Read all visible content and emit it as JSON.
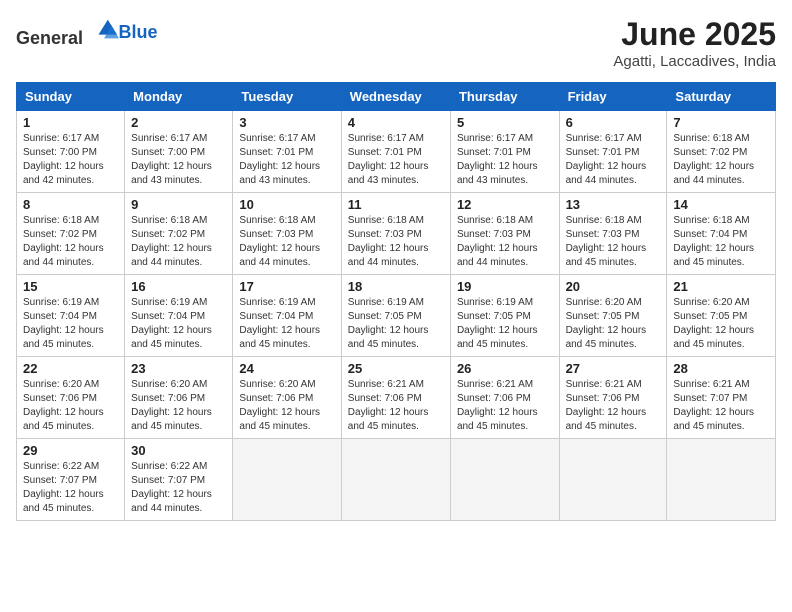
{
  "header": {
    "logo_general": "General",
    "logo_blue": "Blue",
    "month": "June 2025",
    "location": "Agatti, Laccadives, India"
  },
  "weekdays": [
    "Sunday",
    "Monday",
    "Tuesday",
    "Wednesday",
    "Thursday",
    "Friday",
    "Saturday"
  ],
  "weeks": [
    [
      {
        "day": "1",
        "info": "Sunrise: 6:17 AM\nSunset: 7:00 PM\nDaylight: 12 hours\nand 42 minutes."
      },
      {
        "day": "2",
        "info": "Sunrise: 6:17 AM\nSunset: 7:00 PM\nDaylight: 12 hours\nand 43 minutes."
      },
      {
        "day": "3",
        "info": "Sunrise: 6:17 AM\nSunset: 7:01 PM\nDaylight: 12 hours\nand 43 minutes."
      },
      {
        "day": "4",
        "info": "Sunrise: 6:17 AM\nSunset: 7:01 PM\nDaylight: 12 hours\nand 43 minutes."
      },
      {
        "day": "5",
        "info": "Sunrise: 6:17 AM\nSunset: 7:01 PM\nDaylight: 12 hours\nand 43 minutes."
      },
      {
        "day": "6",
        "info": "Sunrise: 6:17 AM\nSunset: 7:01 PM\nDaylight: 12 hours\nand 44 minutes."
      },
      {
        "day": "7",
        "info": "Sunrise: 6:18 AM\nSunset: 7:02 PM\nDaylight: 12 hours\nand 44 minutes."
      }
    ],
    [
      {
        "day": "8",
        "info": "Sunrise: 6:18 AM\nSunset: 7:02 PM\nDaylight: 12 hours\nand 44 minutes."
      },
      {
        "day": "9",
        "info": "Sunrise: 6:18 AM\nSunset: 7:02 PM\nDaylight: 12 hours\nand 44 minutes."
      },
      {
        "day": "10",
        "info": "Sunrise: 6:18 AM\nSunset: 7:03 PM\nDaylight: 12 hours\nand 44 minutes."
      },
      {
        "day": "11",
        "info": "Sunrise: 6:18 AM\nSunset: 7:03 PM\nDaylight: 12 hours\nand 44 minutes."
      },
      {
        "day": "12",
        "info": "Sunrise: 6:18 AM\nSunset: 7:03 PM\nDaylight: 12 hours\nand 44 minutes."
      },
      {
        "day": "13",
        "info": "Sunrise: 6:18 AM\nSunset: 7:03 PM\nDaylight: 12 hours\nand 45 minutes."
      },
      {
        "day": "14",
        "info": "Sunrise: 6:18 AM\nSunset: 7:04 PM\nDaylight: 12 hours\nand 45 minutes."
      }
    ],
    [
      {
        "day": "15",
        "info": "Sunrise: 6:19 AM\nSunset: 7:04 PM\nDaylight: 12 hours\nand 45 minutes."
      },
      {
        "day": "16",
        "info": "Sunrise: 6:19 AM\nSunset: 7:04 PM\nDaylight: 12 hours\nand 45 minutes."
      },
      {
        "day": "17",
        "info": "Sunrise: 6:19 AM\nSunset: 7:04 PM\nDaylight: 12 hours\nand 45 minutes."
      },
      {
        "day": "18",
        "info": "Sunrise: 6:19 AM\nSunset: 7:05 PM\nDaylight: 12 hours\nand 45 minutes."
      },
      {
        "day": "19",
        "info": "Sunrise: 6:19 AM\nSunset: 7:05 PM\nDaylight: 12 hours\nand 45 minutes."
      },
      {
        "day": "20",
        "info": "Sunrise: 6:20 AM\nSunset: 7:05 PM\nDaylight: 12 hours\nand 45 minutes."
      },
      {
        "day": "21",
        "info": "Sunrise: 6:20 AM\nSunset: 7:05 PM\nDaylight: 12 hours\nand 45 minutes."
      }
    ],
    [
      {
        "day": "22",
        "info": "Sunrise: 6:20 AM\nSunset: 7:06 PM\nDaylight: 12 hours\nand 45 minutes."
      },
      {
        "day": "23",
        "info": "Sunrise: 6:20 AM\nSunset: 7:06 PM\nDaylight: 12 hours\nand 45 minutes."
      },
      {
        "day": "24",
        "info": "Sunrise: 6:20 AM\nSunset: 7:06 PM\nDaylight: 12 hours\nand 45 minutes."
      },
      {
        "day": "25",
        "info": "Sunrise: 6:21 AM\nSunset: 7:06 PM\nDaylight: 12 hours\nand 45 minutes."
      },
      {
        "day": "26",
        "info": "Sunrise: 6:21 AM\nSunset: 7:06 PM\nDaylight: 12 hours\nand 45 minutes."
      },
      {
        "day": "27",
        "info": "Sunrise: 6:21 AM\nSunset: 7:06 PM\nDaylight: 12 hours\nand 45 minutes."
      },
      {
        "day": "28",
        "info": "Sunrise: 6:21 AM\nSunset: 7:07 PM\nDaylight: 12 hours\nand 45 minutes."
      }
    ],
    [
      {
        "day": "29",
        "info": "Sunrise: 6:22 AM\nSunset: 7:07 PM\nDaylight: 12 hours\nand 45 minutes."
      },
      {
        "day": "30",
        "info": "Sunrise: 6:22 AM\nSunset: 7:07 PM\nDaylight: 12 hours\nand 44 minutes."
      },
      null,
      null,
      null,
      null,
      null
    ]
  ]
}
